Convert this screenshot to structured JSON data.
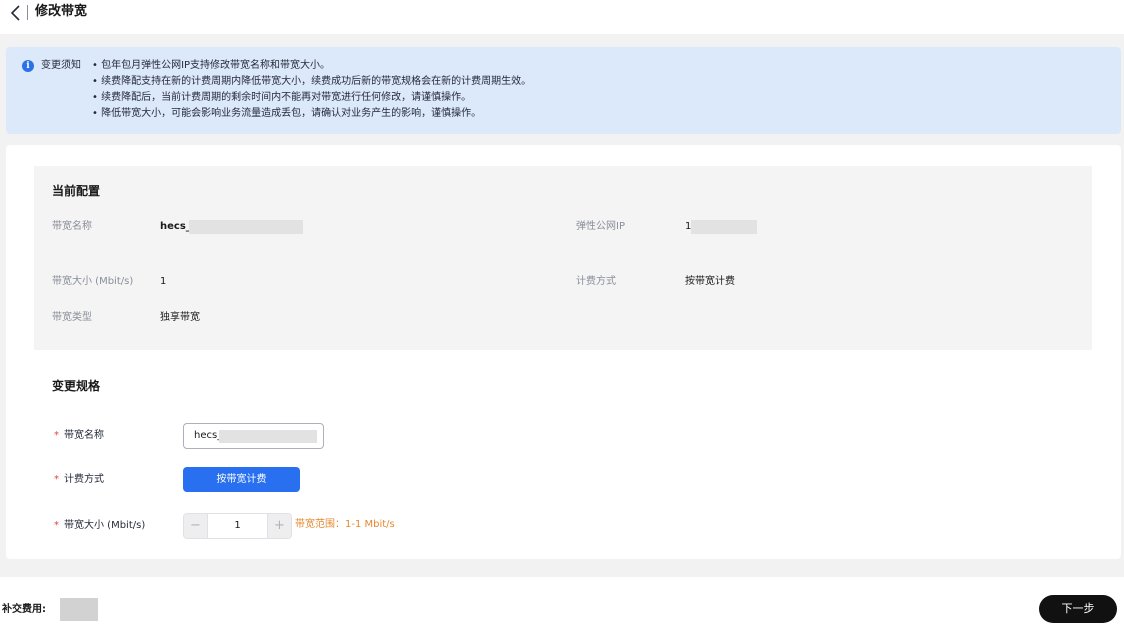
{
  "header": {
    "title": "修改带宽",
    "back_icon": "chevron-left-icon"
  },
  "notice": {
    "icon": "info-icon",
    "label": "变更须知",
    "items": [
      "包年包月弹性公网IP支持修改带宽名称和带宽大小。",
      "续费降配支持在新的计费周期内降低带宽大小，续费成功后新的带宽规格会在新的计费周期生效。",
      "续费降配后，当前计费周期的剩余时间内不能再对带宽进行任何修改，请谨慎操作。",
      "降低带宽大小，可能会影响业务流量造成丢包，请确认对业务产生的影响，谨慎操作。"
    ]
  },
  "current_config": {
    "title": "当前配置",
    "bandwidth_name": {
      "label": "带宽名称",
      "value": "hecs_"
    },
    "eip": {
      "label": "弹性公网IP",
      "value": "1"
    },
    "bandwidth_size": {
      "label": "带宽大小 (Mbit/s)",
      "value": "1"
    },
    "billing_mode": {
      "label": "计费方式",
      "value": "按带宽计费"
    },
    "bandwidth_type": {
      "label": "带宽类型",
      "value": "独享带宽"
    }
  },
  "change_spec": {
    "title": "变更规格",
    "required_mark": "*",
    "name_field": {
      "label": "带宽名称",
      "value": "hecs_"
    },
    "billing_field": {
      "label": "计费方式",
      "button": "按带宽计费"
    },
    "size_field": {
      "label": "带宽大小 (Mbit/s)",
      "value": "1",
      "minus": "−",
      "plus": "+",
      "range_hint": "带宽范围：1-1 Mbit/s"
    }
  },
  "footer": {
    "fee_label": "补交费用:",
    "next_button": "下一步"
  },
  "colors": {
    "primary": "#2970f0",
    "notice_bg": "#dce9fb",
    "hint": "#e5882f",
    "dark_button": "#111111"
  }
}
